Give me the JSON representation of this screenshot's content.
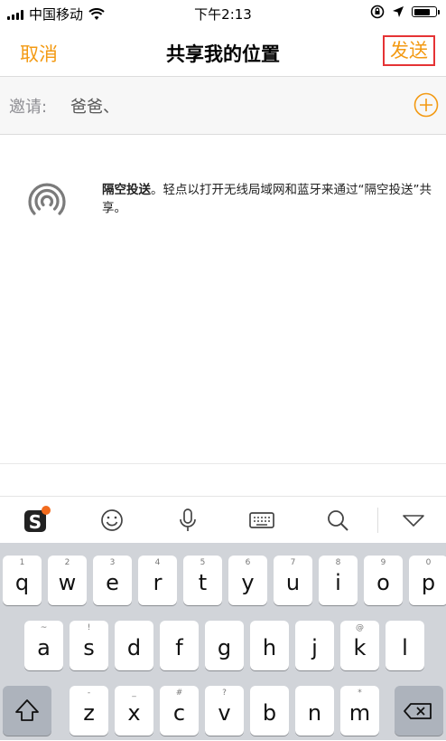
{
  "status_bar": {
    "carrier": "中国移动",
    "time": "下午2:13",
    "battery_level": 0.8
  },
  "nav": {
    "cancel_label": "取消",
    "title": "共享我的位置",
    "send_label": "发送"
  },
  "invite": {
    "label": "邀请:",
    "value": "爸爸、"
  },
  "airdrop": {
    "title": "隔空投送",
    "text": "。轻点以打开无线局域网和蓝牙来通过“隔空投送”共享。"
  },
  "keyboard": {
    "row1": [
      {
        "hint": "1",
        "key": "q"
      },
      {
        "hint": "2",
        "key": "w"
      },
      {
        "hint": "3",
        "key": "e"
      },
      {
        "hint": "4",
        "key": "r"
      },
      {
        "hint": "5",
        "key": "t"
      },
      {
        "hint": "6",
        "key": "y"
      },
      {
        "hint": "7",
        "key": "u"
      },
      {
        "hint": "8",
        "key": "i"
      },
      {
        "hint": "9",
        "key": "o"
      },
      {
        "hint": "0",
        "key": "p"
      }
    ],
    "row2": [
      {
        "hint": "~",
        "key": "a"
      },
      {
        "hint": "!",
        "key": "s"
      },
      {
        "hint": "",
        "key": "d"
      },
      {
        "hint": "",
        "key": "f"
      },
      {
        "hint": "",
        "key": "g"
      },
      {
        "hint": "",
        "key": "h"
      },
      {
        "hint": "",
        "key": "j"
      },
      {
        "hint": "@",
        "key": "k"
      },
      {
        "hint": "",
        "key": "l"
      }
    ],
    "row3": [
      {
        "hint": "-",
        "key": "z"
      },
      {
        "hint": "_",
        "key": "x"
      },
      {
        "hint": "#",
        "key": "c"
      },
      {
        "hint": "?",
        "key": "v"
      },
      {
        "hint": "",
        "key": "b"
      },
      {
        "hint": "",
        "key": "n"
      },
      {
        "hint": "*",
        "key": "m"
      }
    ]
  }
}
